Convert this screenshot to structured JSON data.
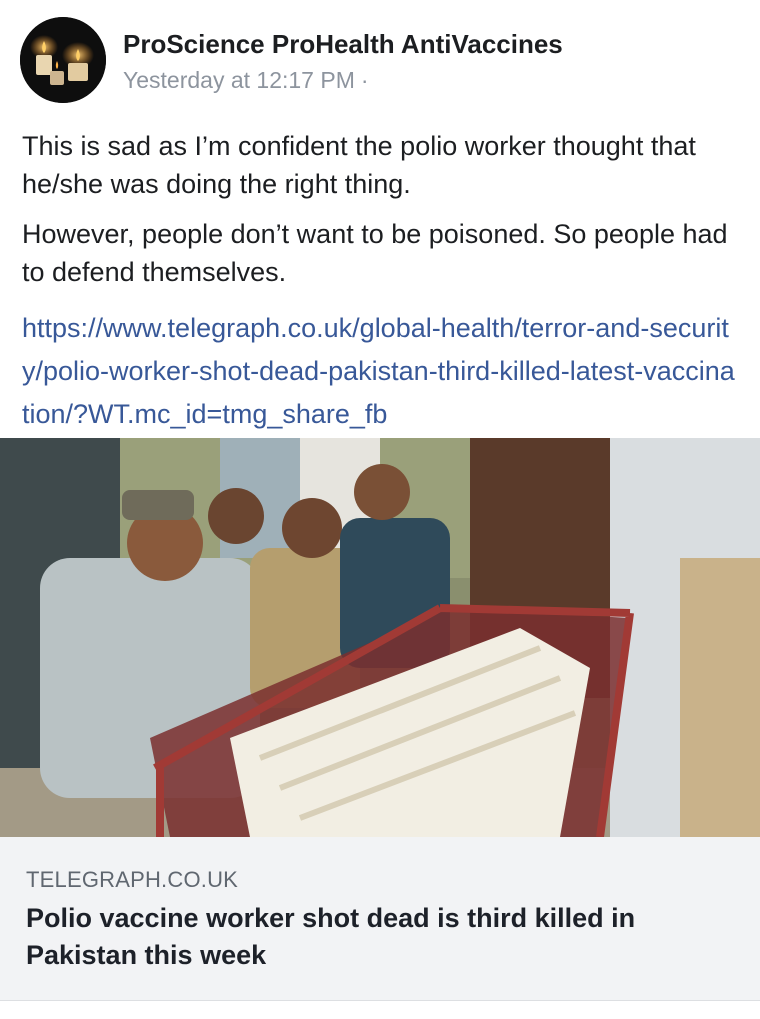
{
  "post": {
    "page_name": "ProScience ProHealth AntiVaccines",
    "timestamp": "Yesterday at 12:17 PM",
    "meta_separator": "·",
    "avatar_icon": "candles-icon",
    "paragraphs": [
      "This is sad as I’m confident the polio worker thought that he/she was doing the right thing.",
      "However, people don’t want to be poisoned. So people had to defend themselves."
    ],
    "link_url": "https://www.telegraph.co.uk/global-health/terror-and-security/polio-worker-shot-dead-pakistan-third-killed-latest-vaccination/?WT.mc_id=tmg_share_fb"
  },
  "link_preview": {
    "domain": "TELEGRAPH.CO.UK",
    "title": "Polio vaccine worker shot dead is third killed in Pakistan this week"
  },
  "colors": {
    "link": "#385898",
    "meta": "#8d949e",
    "preview_background": "#f2f3f5"
  }
}
